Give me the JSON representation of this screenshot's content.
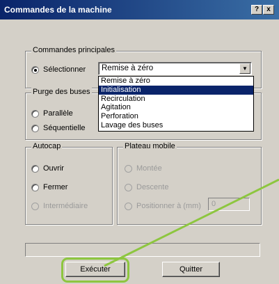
{
  "window": {
    "title": "Commandes de la machine",
    "help_button": "?",
    "close_button": "x"
  },
  "commandes_principales": {
    "legend": "Commandes principales",
    "radio_label": "Sélectionner",
    "combo_value": "Remise à zéro",
    "dropdown_options": [
      "Remise à zéro",
      "Initialisation",
      "Recirculation",
      "Agitation",
      "Perforation",
      "Lavage des buses"
    ],
    "highlighted_option": "Initialisation"
  },
  "purge": {
    "legend": "Purge des buses",
    "option1": "Parallèle",
    "option2": "Séquentielle"
  },
  "autocap": {
    "legend": "Autocap",
    "option1": "Ouvrir",
    "option2": "Fermer",
    "option3": "Intermédiaire"
  },
  "plateau": {
    "legend": "Plateau mobile",
    "option1": "Montée",
    "option2": "Descente",
    "option3": "Positionner à (mm)",
    "position_value": "0"
  },
  "buttons": {
    "execute": "Exécuter",
    "quit": "Quitter"
  },
  "colors": {
    "highlight_ring": "#8dc63f",
    "title_bar": "#0a246a",
    "selection": "#0a246a"
  }
}
